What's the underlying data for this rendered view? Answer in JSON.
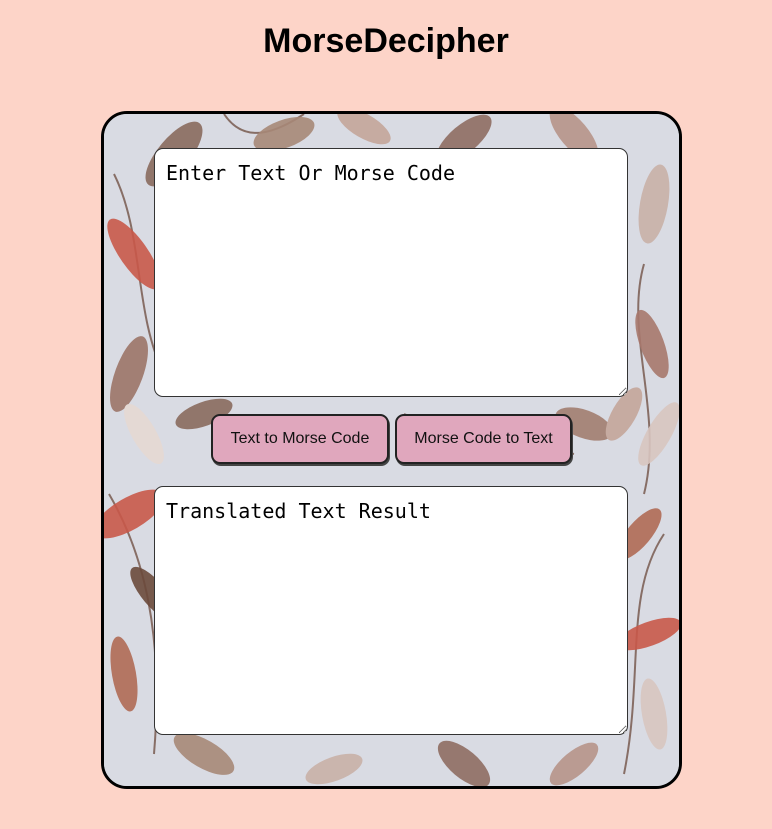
{
  "app": {
    "title": "MorseDecipher"
  },
  "input": {
    "placeholder": "Enter Text Or Morse Code",
    "value": ""
  },
  "actions": {
    "text_to_morse_label": "Text to Morse Code",
    "morse_to_text_label": "Morse Code to Text"
  },
  "output": {
    "placeholder": "Translated Text Result",
    "value": ""
  },
  "colors": {
    "page_background": "#fdd4c8",
    "card_background": "#d9dbe3",
    "button_background": "#e0a7bd",
    "leaf_accent": "#c9584a"
  }
}
